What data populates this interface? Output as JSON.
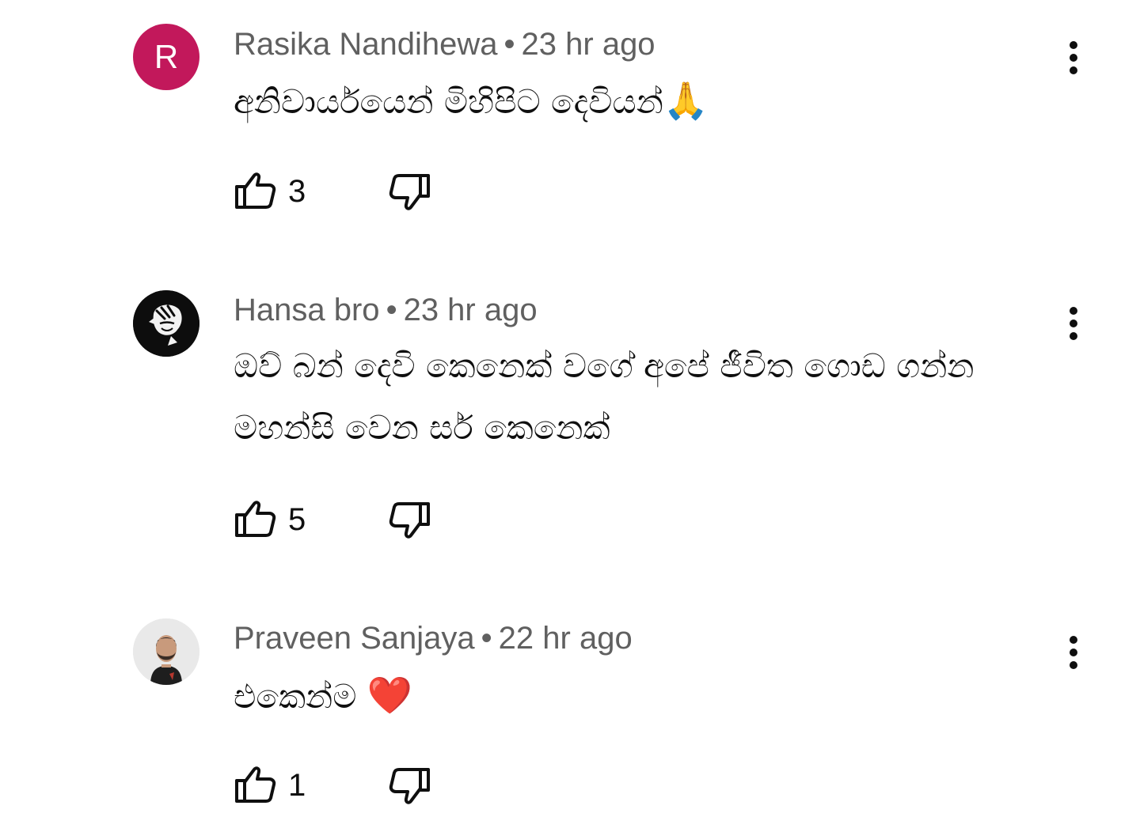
{
  "comments": [
    {
      "author": "Rasika Nandihewa",
      "separator": "•",
      "time": "23 hr ago",
      "avatar_letter": "R",
      "avatar_color": "#c2185b",
      "text": "අනිවාර්යයෙන් මිහිපිට දෙවියන්",
      "emoji": "🙏",
      "likes": "3"
    },
    {
      "author": "Hansa bro",
      "separator": "•",
      "time": "23 hr ago",
      "text": "ඔව් බන් දෙවි කෙනෙක් වගේ අපේ ජීවිත ගොඩ ගන්න මහන්සි වෙන සර් කෙනෙක්",
      "likes": "5"
    },
    {
      "author": "Praveen Sanjaya",
      "separator": "•",
      "time": "22 hr ago",
      "text": "එකෙන්ම",
      "emoji": "❤️",
      "likes": "1"
    }
  ],
  "icons": {
    "menu": "more-vert-icon",
    "like": "thumbs-up-icon",
    "dislike": "thumbs-down-icon"
  },
  "colors": {
    "meta_text": "#606060",
    "body_text": "#0f0f0f"
  }
}
